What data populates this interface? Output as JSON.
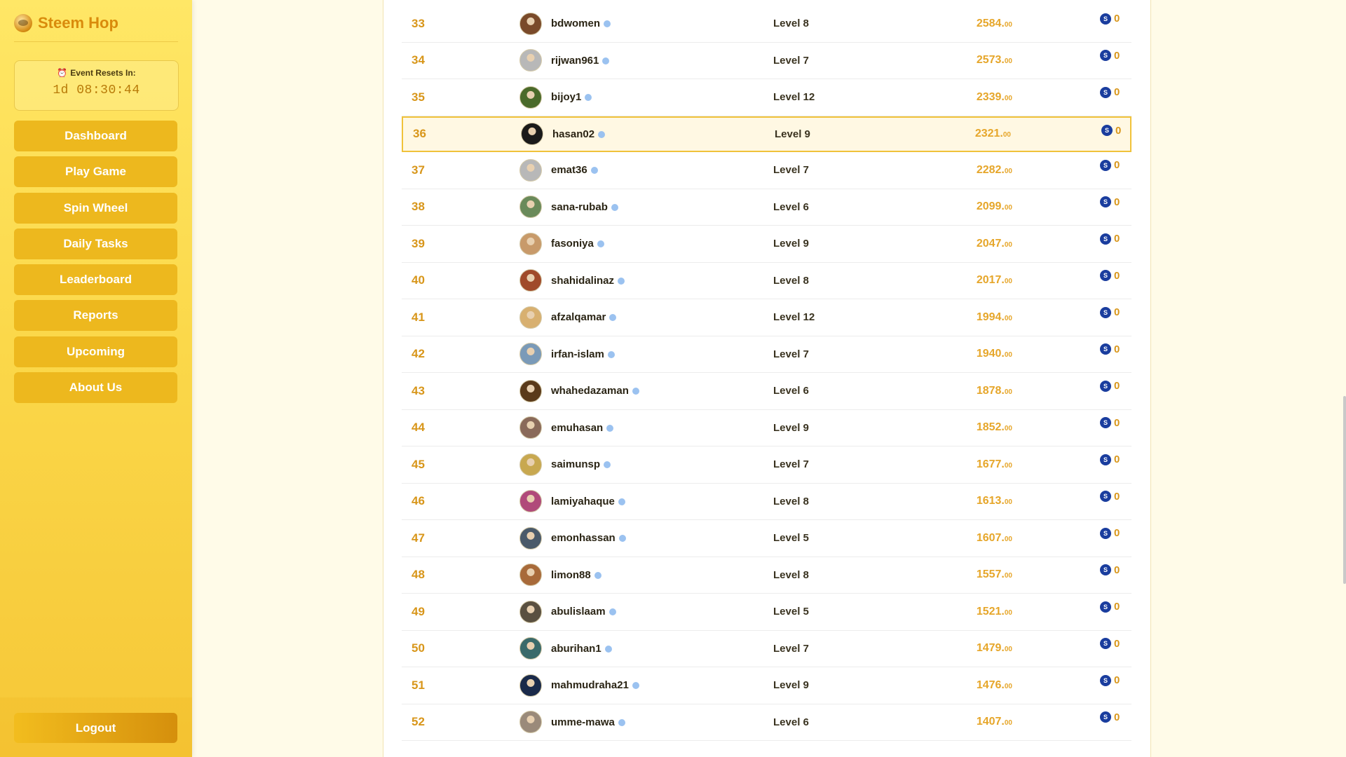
{
  "brand": {
    "title": "Steem Hop"
  },
  "event": {
    "label": "Event Resets In:",
    "time": "1d 08:30:44"
  },
  "nav": [
    "Dashboard",
    "Play Game",
    "Spin Wheel",
    "Daily Tasks",
    "Leaderboard",
    "Reports",
    "Upcoming",
    "About Us"
  ],
  "logout_label": "Logout",
  "highlight_rank": "36",
  "avatar_colors": [
    "#7a4a2a",
    "#b8b8b8",
    "#4a6a2a",
    "#1a1a1a",
    "#b8b8b8",
    "#6a8a5a",
    "#c89a6a",
    "#a04a2a",
    "#d8b070",
    "#7a9ab8",
    "#5a3a1a",
    "#8a6a5a",
    "#c8a850",
    "#b04a7a",
    "#4a5a6a",
    "#a86a3a",
    "#5a5040",
    "#3a6a6a",
    "#1a2a4a",
    "#9a8a7a"
  ],
  "rows": [
    {
      "rank": "33",
      "user": "bdwomen",
      "level": "Level 8",
      "score": "2584",
      "dec": "00",
      "reward": "0"
    },
    {
      "rank": "34",
      "user": "rijwan961",
      "level": "Level 7",
      "score": "2573",
      "dec": "00",
      "reward": "0"
    },
    {
      "rank": "35",
      "user": "bijoy1",
      "level": "Level 12",
      "score": "2339",
      "dec": "00",
      "reward": "0"
    },
    {
      "rank": "36",
      "user": "hasan02",
      "level": "Level 9",
      "score": "2321",
      "dec": "00",
      "reward": "0"
    },
    {
      "rank": "37",
      "user": "emat36",
      "level": "Level 7",
      "score": "2282",
      "dec": "00",
      "reward": "0"
    },
    {
      "rank": "38",
      "user": "sana-rubab",
      "level": "Level 6",
      "score": "2099",
      "dec": "00",
      "reward": "0"
    },
    {
      "rank": "39",
      "user": "fasoniya",
      "level": "Level 9",
      "score": "2047",
      "dec": "00",
      "reward": "0"
    },
    {
      "rank": "40",
      "user": "shahidalinaz",
      "level": "Level 8",
      "score": "2017",
      "dec": "00",
      "reward": "0"
    },
    {
      "rank": "41",
      "user": "afzalqamar",
      "level": "Level 12",
      "score": "1994",
      "dec": "00",
      "reward": "0"
    },
    {
      "rank": "42",
      "user": "irfan-islam",
      "level": "Level 7",
      "score": "1940",
      "dec": "00",
      "reward": "0"
    },
    {
      "rank": "43",
      "user": "whahedazaman",
      "level": "Level 6",
      "score": "1878",
      "dec": "00",
      "reward": "0"
    },
    {
      "rank": "44",
      "user": "emuhasan",
      "level": "Level 9",
      "score": "1852",
      "dec": "00",
      "reward": "0"
    },
    {
      "rank": "45",
      "user": "saimunsp",
      "level": "Level 7",
      "score": "1677",
      "dec": "00",
      "reward": "0"
    },
    {
      "rank": "46",
      "user": "lamiyahaque",
      "level": "Level 8",
      "score": "1613",
      "dec": "00",
      "reward": "0"
    },
    {
      "rank": "47",
      "user": "emonhassan",
      "level": "Level 5",
      "score": "1607",
      "dec": "00",
      "reward": "0"
    },
    {
      "rank": "48",
      "user": "limon88",
      "level": "Level 8",
      "score": "1557",
      "dec": "00",
      "reward": "0"
    },
    {
      "rank": "49",
      "user": "abulislaam",
      "level": "Level 5",
      "score": "1521",
      "dec": "00",
      "reward": "0"
    },
    {
      "rank": "50",
      "user": "aburihan1",
      "level": "Level 7",
      "score": "1479",
      "dec": "00",
      "reward": "0"
    },
    {
      "rank": "51",
      "user": "mahmudraha21",
      "level": "Level 9",
      "score": "1476",
      "dec": "00",
      "reward": "0"
    },
    {
      "rank": "52",
      "user": "umme-mawa",
      "level": "Level 6",
      "score": "1407",
      "dec": "00",
      "reward": "0"
    }
  ],
  "icons": {
    "brand": "dog-coin-logo-icon",
    "clock": "alarm-clock-icon",
    "reward": "steem-icon",
    "verified": "info-dot-icon"
  }
}
